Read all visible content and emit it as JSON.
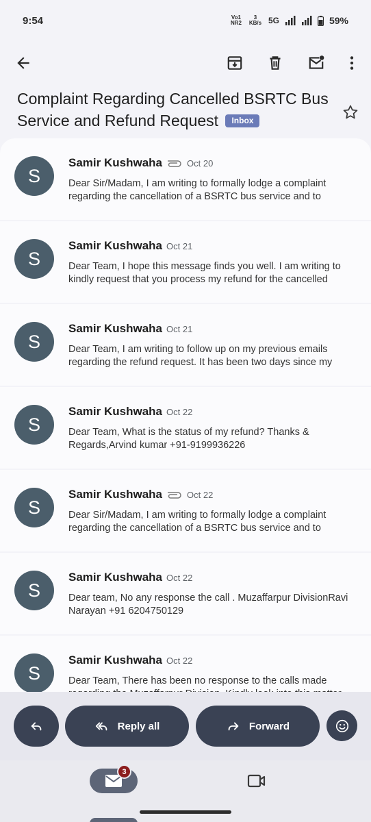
{
  "status_bar": {
    "time": "9:54",
    "volte": "Vo1 NR2",
    "speed": "3 KB/s",
    "network": "5G",
    "battery": "59%"
  },
  "toolbar": {
    "icons": [
      "back-arrow-icon",
      "archive-icon",
      "delete-icon",
      "mark-unread-icon",
      "more-vert-icon"
    ]
  },
  "subject": {
    "text": "Complaint Regarding Cancelled BSRTC Bus Service and Refund Request",
    "label": "Inbox"
  },
  "messages": [
    {
      "avatar": "S",
      "sender": "Samir Kushwaha",
      "attachment": true,
      "date": "Oct 20",
      "snippet": "Dear Sir/Madam, I am writing to formally lodge a complaint regarding the cancellation of a BSRTC bus service and to"
    },
    {
      "avatar": "S",
      "sender": "Samir Kushwaha",
      "attachment": false,
      "date": "Oct 21",
      "snippet": "Dear Team, I hope this message finds you well. I am writing to kindly request that you process my refund for the cancelled"
    },
    {
      "avatar": "S",
      "sender": "Samir Kushwaha",
      "attachment": false,
      "date": "Oct 21",
      "snippet": "Dear Team, I am writing to follow up on my previous emails regarding the refund request. It has been two days since my"
    },
    {
      "avatar": "S",
      "sender": "Samir Kushwaha",
      "attachment": false,
      "date": "Oct 22",
      "snippet": "Dear Team, What is the status of my refund? Thanks & Regards,Arvind kumar +91-9199936226"
    },
    {
      "avatar": "S",
      "sender": "Samir Kushwaha",
      "attachment": true,
      "date": "Oct 22",
      "snippet": "Dear Sir/Madam, I am writing to formally lodge a complaint regarding the cancellation of a BSRTC bus service and to"
    },
    {
      "avatar": "S",
      "sender": "Samir Kushwaha",
      "attachment": false,
      "date": "Oct 22",
      "snippet": "Dear team, No any response the call . Muzaffarpur DivisionRavi Narayan +91 6204750129"
    },
    {
      "avatar": "S",
      "sender": "Samir Kushwaha",
      "attachment": false,
      "date": "Oct 22",
      "snippet": "Dear Team, There has been no response to the calls made regarding the Muzaffarpur Division. Kindly look into this matter"
    }
  ],
  "actions": {
    "reply_all": "Reply all",
    "forward": "Forward"
  },
  "bottom_nav": {
    "mail_badge": "3"
  }
}
